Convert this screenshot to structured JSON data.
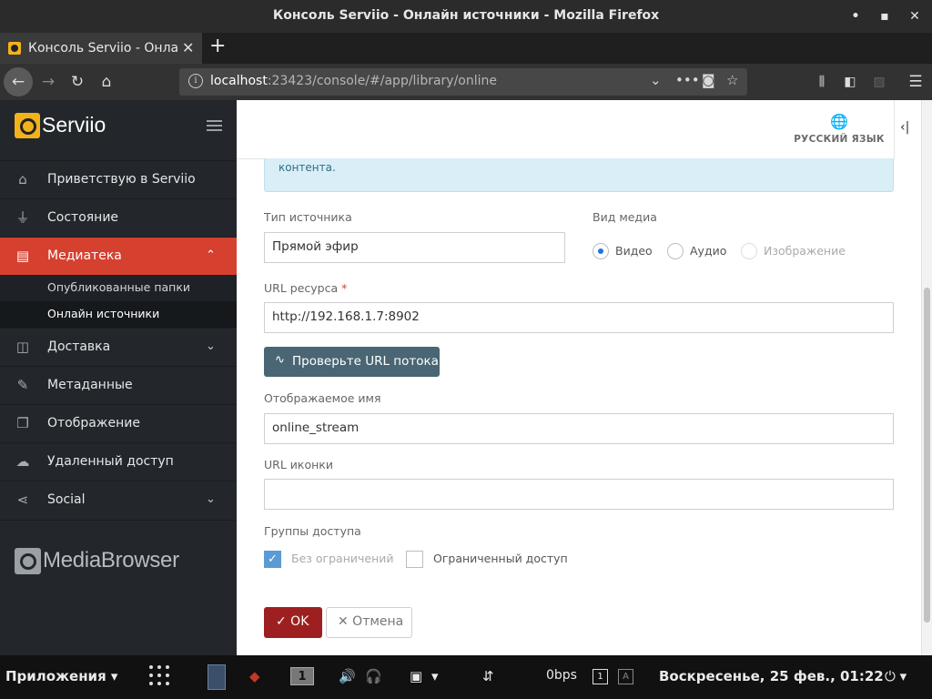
{
  "window": {
    "title": "Консоль Serviio - Онлайн источники - Mozilla Firefox",
    "minimize_glyph": "•",
    "maximize_glyph": "▪",
    "close_glyph": "✕"
  },
  "tab": {
    "label": "Консоль Serviio - Онлайн источники",
    "close_glyph": "✕",
    "new_tab_glyph": "+"
  },
  "navbar": {
    "url_host": "localhost",
    "url_rest": ":23423/console/#/app/library/online"
  },
  "sidebar": {
    "logo_text": "Serviio",
    "items": [
      {
        "label": "Приветствую в Serviio",
        "icon": "home-icon",
        "glyph": "⌂"
      },
      {
        "label": "Состояние",
        "icon": "plug-icon",
        "glyph": "⏚"
      },
      {
        "label": "Медиатека",
        "icon": "library-icon",
        "glyph": "▤"
      },
      {
        "label": "Доставка",
        "icon": "box-icon",
        "glyph": "◫"
      },
      {
        "label": "Метаданные",
        "icon": "edit-icon",
        "glyph": "✎"
      },
      {
        "label": "Отображение",
        "icon": "copy-icon",
        "glyph": "❐"
      },
      {
        "label": "Удаленный доступ",
        "icon": "cloud-icon",
        "glyph": "☁"
      },
      {
        "label": "Social",
        "icon": "share-icon",
        "glyph": "⋖"
      }
    ],
    "library_subitems": [
      {
        "label": "Опубликованные папки"
      },
      {
        "label": "Онлайн источники"
      }
    ],
    "chevron_up": "⌃",
    "chevron_down": "⌄",
    "footer_logo_text": "MediaBrowser"
  },
  "header": {
    "language_label": "РУССКИЙ ЯЗЫК",
    "globe_glyph": "🌐",
    "collapse_glyph": "‹|"
  },
  "form": {
    "info_text": "контента.",
    "source_type_label": "Тип источника",
    "source_type_value": "Прямой эфир",
    "media_type_label": "Вид медиа",
    "media_options": [
      {
        "label": "Видео"
      },
      {
        "label": "Аудио"
      },
      {
        "label": "Изображение"
      }
    ],
    "url_label": "URL ресурса",
    "required_mark": "*",
    "url_value": "http://192.168.1.7:8902",
    "check_button": "Проверьте URL потока",
    "check_icon_glyph": "∿",
    "display_name_label": "Отображаемое имя",
    "display_name_value": "online_stream",
    "icon_url_label": "URL иконки",
    "icon_url_value": "",
    "access_groups_label": "Группы доступа",
    "access_options": [
      {
        "label": "Без ограничений",
        "checked": true
      },
      {
        "label": "Ограниченный доступ",
        "checked": false
      }
    ],
    "ok_button": "✓ OK",
    "cancel_button": "✕ Отмена"
  },
  "taskbar": {
    "apps_label": "Приложения ▾",
    "workspace": "1",
    "net_speed": "0bps",
    "clock": "Воскресенье, 25 фев., 01:22",
    "power_glyph": "⏻ ▾"
  }
}
